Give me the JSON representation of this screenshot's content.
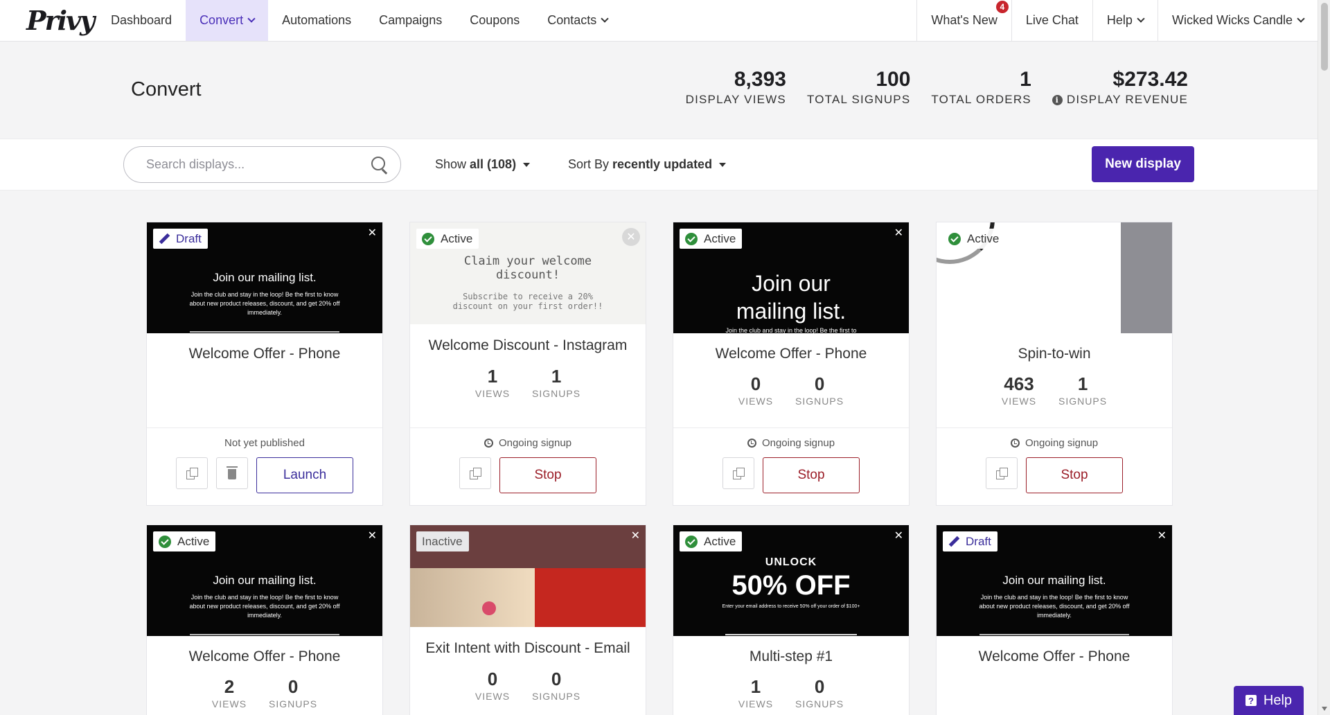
{
  "logo": {
    "text": "Privy"
  },
  "nav": {
    "left": [
      {
        "label": "Dashboard",
        "active": false,
        "dropdown": false
      },
      {
        "label": "Convert",
        "active": true,
        "dropdown": true
      },
      {
        "label": "Automations",
        "active": false,
        "dropdown": false
      },
      {
        "label": "Campaigns",
        "active": false,
        "dropdown": false
      },
      {
        "label": "Coupons",
        "active": false,
        "dropdown": false
      },
      {
        "label": "Contacts",
        "active": false,
        "dropdown": true
      }
    ],
    "whats_new": {
      "label": "What's New",
      "badge": "4"
    },
    "live_chat": "Live Chat",
    "help": "Help",
    "account": "Wicked Wicks Candle"
  },
  "header": {
    "title": "Convert",
    "stats": [
      {
        "value": "8,393",
        "label": "DISPLAY VIEWS"
      },
      {
        "value": "100",
        "label": "TOTAL SIGNUPS"
      },
      {
        "value": "1",
        "label": "TOTAL ORDERS"
      },
      {
        "value": "$273.42",
        "label": "DISPLAY REVENUE",
        "info": true
      }
    ]
  },
  "toolbar": {
    "search_placeholder": "Search displays...",
    "show_prefix": "Show",
    "show_value": "all (108)",
    "sort_prefix": "Sort By",
    "sort_value": "recently updated",
    "new_display": "New display"
  },
  "cards": [
    {
      "status": "Draft",
      "name": "Welcome Offer - Phone",
      "footer_status": "Not yet published",
      "action": "Launch",
      "thumb": {
        "head": "Join our mailing list.",
        "body": "Join the club and stay in the loop! Be the first to know about new product releases, discount, and get 20% off immediately."
      }
    },
    {
      "status": "Active",
      "name": "Welcome Discount - Instagram",
      "views": "1",
      "signups": "1",
      "footer_status": "Ongoing signup",
      "action": "Stop",
      "thumb": {
        "head": "Claim your welcome discount!",
        "body": "Subscribe to receive a 20% discount on your first order!!"
      }
    },
    {
      "status": "Active",
      "name": "Welcome Offer - Phone",
      "views": "0",
      "signups": "0",
      "footer_status": "Ongoing signup",
      "action": "Stop",
      "thumb": {
        "head": "Join our mailing list.",
        "body": "Join the club and stay in the loop! Be the first to"
      }
    },
    {
      "status": "Active",
      "name": "Spin-to-win",
      "views": "463",
      "signups": "1",
      "footer_status": "Ongoing signup",
      "action": "Stop"
    },
    {
      "status": "Active",
      "name": "Welcome Offer - Phone",
      "views": "2",
      "signups": "0",
      "thumb": {
        "head": "Join our mailing list.",
        "body": "Join the club and stay in the loop! Be the first to know about new product releases, discount, and get 20% off immediately."
      }
    },
    {
      "status": "Inactive",
      "name": "Exit Intent with Discount - Email",
      "views": "0",
      "signups": "0"
    },
    {
      "status": "Active",
      "name": "Multi-step #1",
      "views": "1",
      "signups": "0",
      "thumb": {
        "head": "UNLOCK",
        "big": "50% OFF",
        "body": "Enter your email address to receive 50% off your order of $100+"
      }
    },
    {
      "status": "Draft",
      "name": "Welcome Offer - Phone",
      "thumb": {
        "head": "Join our mailing list.",
        "body": "Join the club and stay in the loop! Be the first to know about new product releases, discount, and get 20% off immediately."
      }
    }
  ],
  "labels": {
    "views": "VIEWS",
    "signups": "SIGNUPS"
  },
  "help_button": "Help",
  "colors": {
    "brand": "#4a25ae",
    "active_nav_bg": "#e6e2fa",
    "stop": "#9b1e28",
    "active_check": "#2f8f3b"
  }
}
